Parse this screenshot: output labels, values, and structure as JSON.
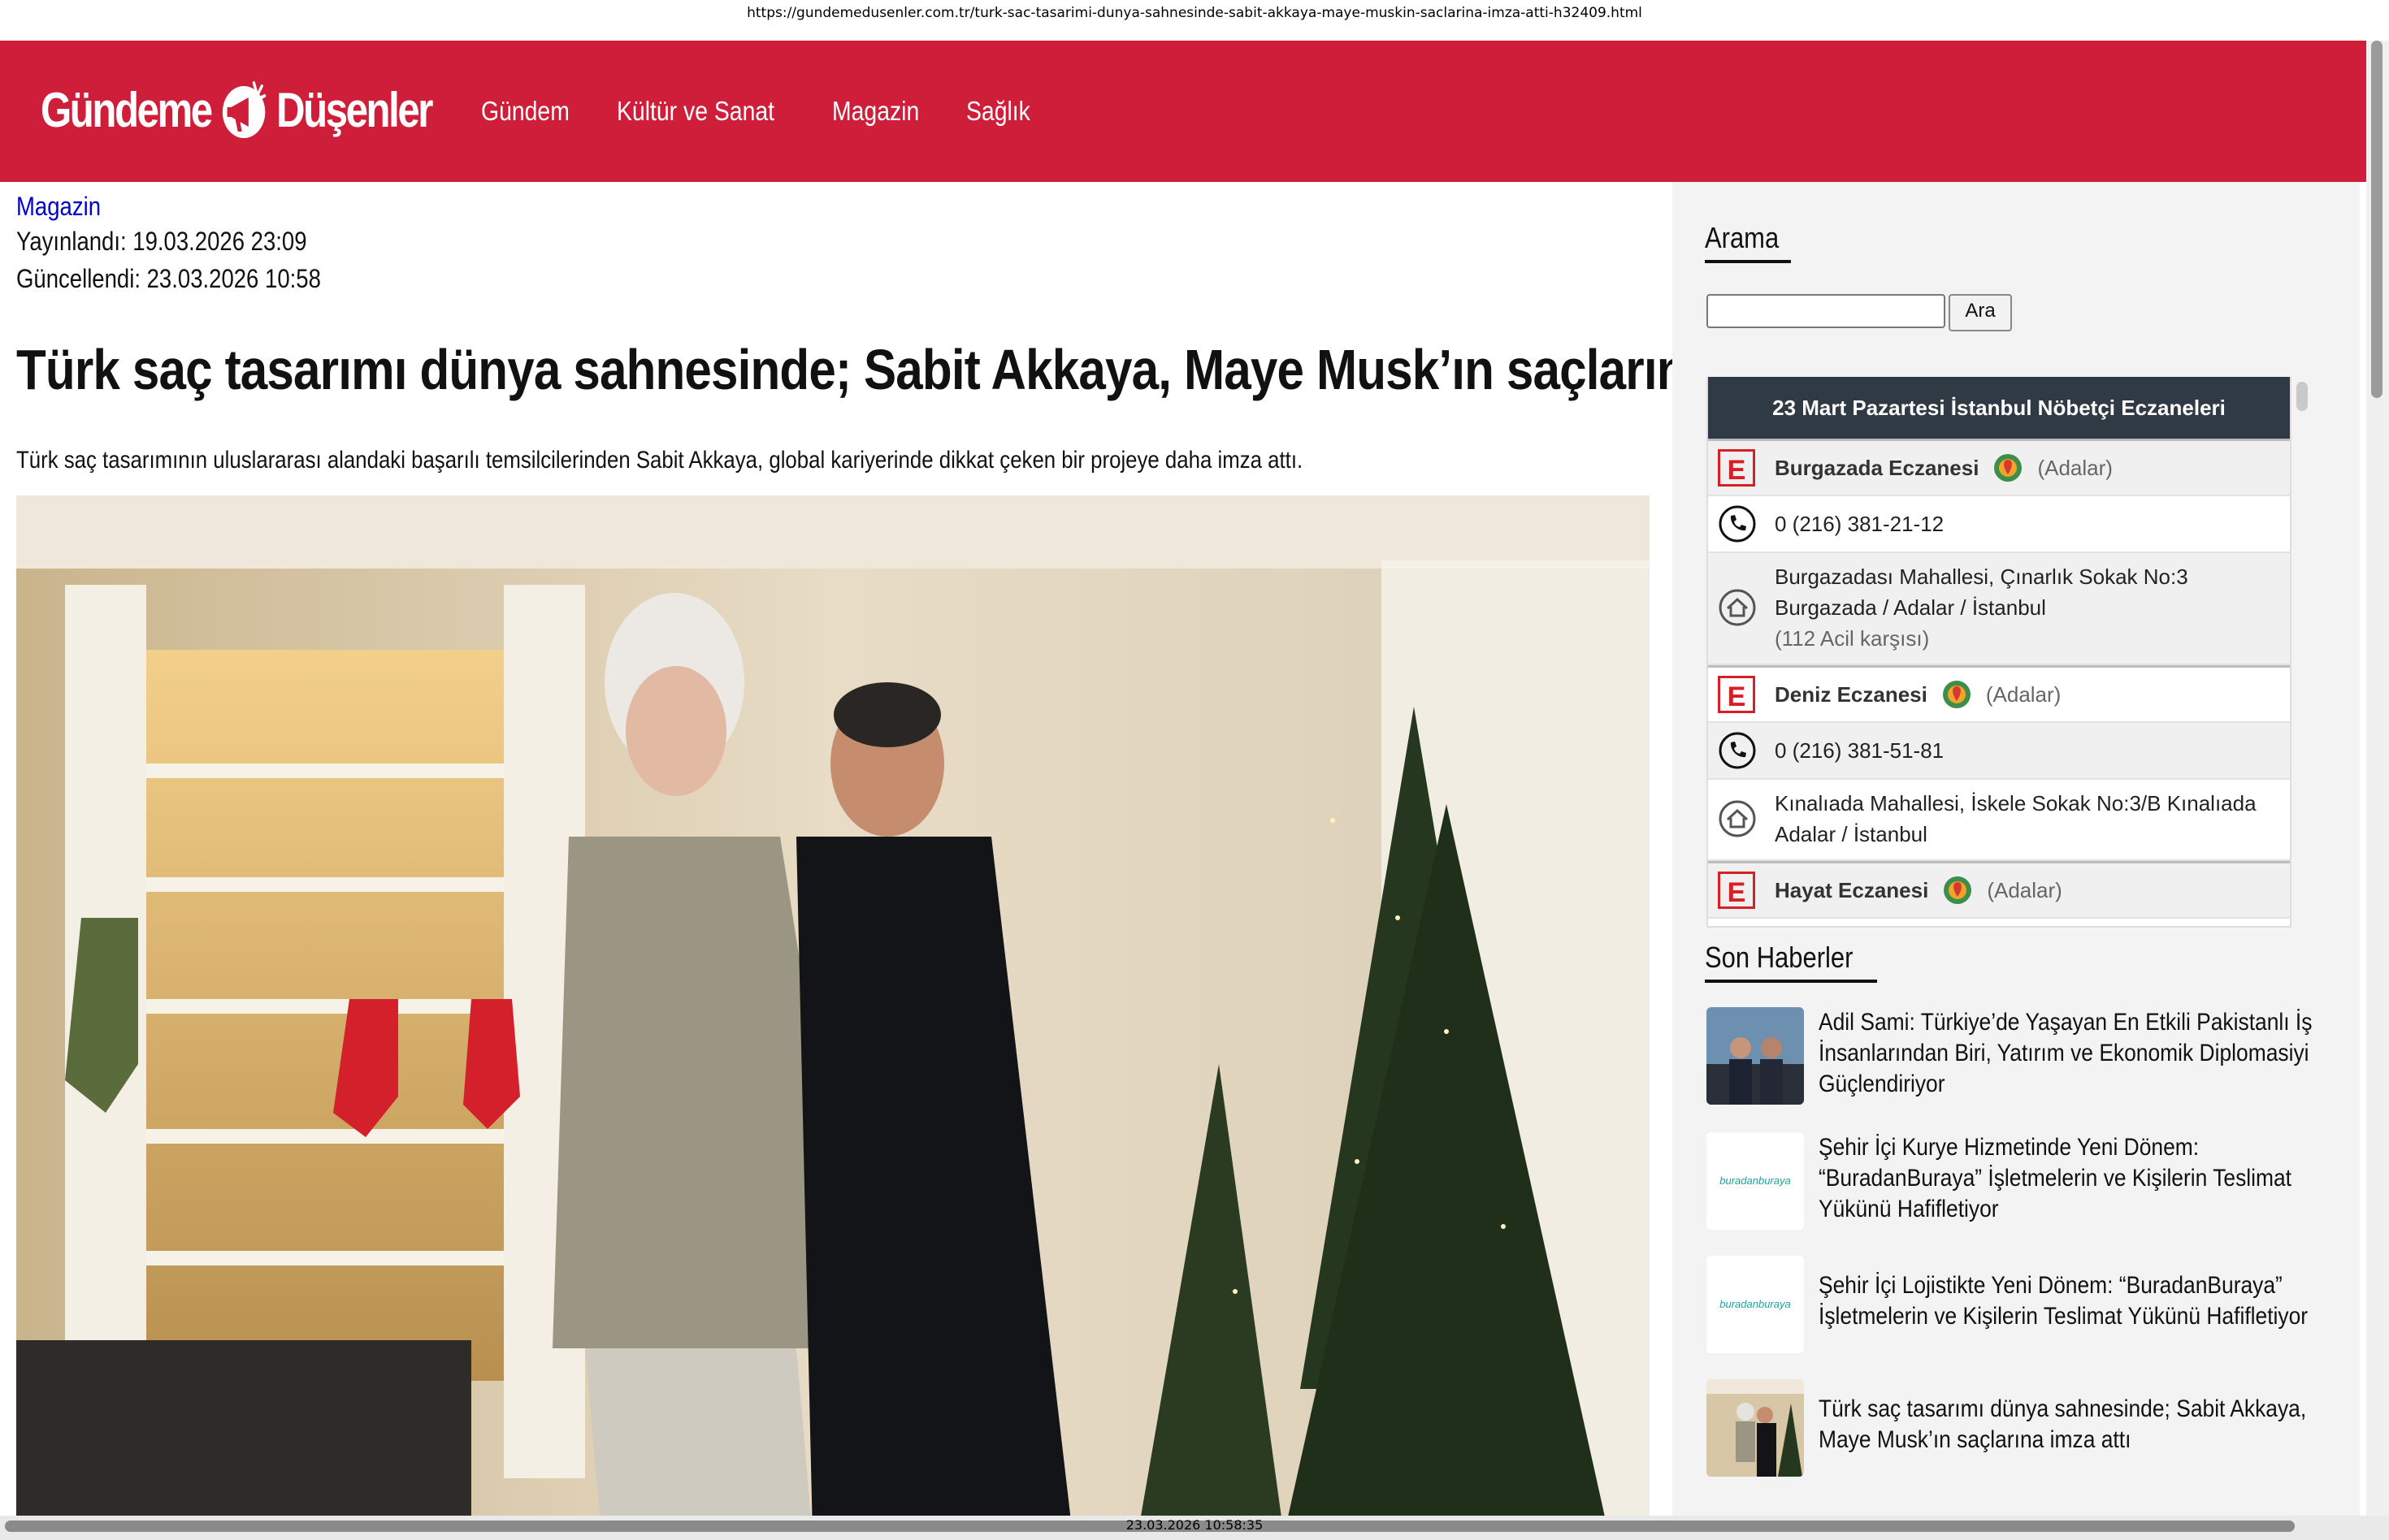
{
  "browser": {
    "url": "https://gundemedusenler.com.tr/turk-sac-tasarimi-dunya-sahnesinde-sabit-akkaya-maye-muskin-saclarina-imza-atti-h32409.html",
    "timestamp": "23.03.2026 10:58:35"
  },
  "site": {
    "logo_left": "Gündeme",
    "logo_right": "Düşenler",
    "nav": [
      "Gündem",
      "Kültür ve Sanat",
      "Magazin",
      "Sağlık"
    ],
    "brand_color": "#cf1e3a"
  },
  "article": {
    "category": "Magazin",
    "published": "Yayınlandı: 19.03.2026 23:09",
    "updated": "Güncellendi: 23.03.2026 10:58",
    "title": "Türk saç tasarımı dünya sahnesinde; Sabit Akkaya, Maye Musk’ın saçlarına imza attı",
    "lede": "Türk saç tasarımının uluslararası alandaki başarılı temsilcilerinden Sabit Akkaya, global kariyerinde dikkat çeken bir projeye daha imza attı."
  },
  "sidebar": {
    "search_title": "Arama",
    "search_button": "Ara",
    "pharmacy_title": "23 Mart Pazartesi İstanbul Nöbetçi Eczaneleri",
    "pharmacies": [
      {
        "name": "Burgazada Eczanesi",
        "area": "(Adalar)",
        "phone": "0 (216) 381-21-12",
        "address": "Burgazadası Mahallesi, Çınarlık Sokak No:3 Burgazada / Adalar / İstanbul",
        "note": "(112 Acil karşısı)"
      },
      {
        "name": "Deniz Eczanesi",
        "area": "(Adalar)",
        "phone": "0 (216) 381-51-81",
        "address": "Kınalıada Mahallesi, İskele Sokak No:3/B Kınalıada Adalar / İstanbul"
      },
      {
        "name": "Hayat Eczanesi",
        "area": "(Adalar)"
      }
    ],
    "news_title": "Son Haberler",
    "news": [
      "Adil Sami: Türkiye’de Yaşayan En Etkili Pakistanlı İş İnsanlarından Biri, Yatırım ve Ekonomik Diplomasiyi Güçlendiriyor",
      "Şehir İçi Kurye Hizmetinde Yeni Dönem: “BuradanBuraya” İşletmelerin ve Kişilerin Teslimat Yükünü Hafifletiyor",
      "Şehir İçi Lojistikte Yeni Dönem: “BuradanBuraya” İşletmelerin ve Kişilerin Teslimat Yükünü Hafifletiyor",
      "Türk saç tasarımı dünya sahnesinde; Sabit Akkaya, Maye Musk’ın saçlarına imza attı"
    ],
    "thumb_logo_text": "buradanburaya"
  }
}
